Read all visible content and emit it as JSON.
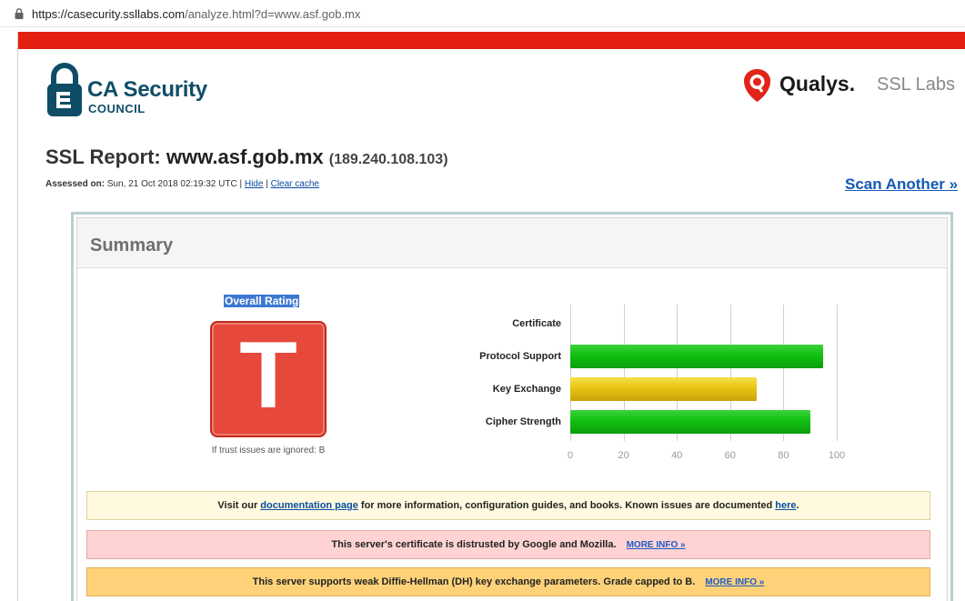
{
  "browser": {
    "url_host_prefix": "https://casecurity.ssllabs.com",
    "url_path": "/analyze.html?d=www.asf.gob.mx"
  },
  "header": {
    "ca_title": "CA Security",
    "ca_subtitle": "COUNCIL",
    "qualys_name": "Qualys.",
    "qualys_ssl": "SSL Labs"
  },
  "report": {
    "title_prefix": "SSL Report:",
    "domain": "www.asf.gob.mx",
    "ip": "(189.240.108.103)",
    "assessed_label": "Assessed on:",
    "assessed_value": "Sun, 21 Oct 2018 02:19:32 UTC |",
    "hide_link": "Hide",
    "separator": "|",
    "clear_cache_link": "Clear cache",
    "scan_another": "Scan Another »"
  },
  "summary": {
    "title": "Summary",
    "overall_label": "Overall Rating",
    "grade": "T",
    "trust_note": "If trust issues are ignored: B",
    "colors": {
      "grade_bg": "#e6493b",
      "bar_green": "#11c011",
      "bar_yellow": "#e8c412"
    }
  },
  "chart_data": {
    "type": "bar",
    "orientation": "horizontal",
    "categories": [
      "Certificate",
      "Protocol Support",
      "Key Exchange",
      "Cipher Strength"
    ],
    "values": [
      0,
      95,
      70,
      90
    ],
    "xlim": [
      0,
      100
    ],
    "ticks": [
      "0",
      "20",
      "40",
      "60",
      "80",
      "100"
    ],
    "grid": true
  },
  "notices": {
    "docs_pre": "Visit our",
    "docs_link": "documentation page",
    "docs_mid": "for more information, configuration guides, and books. Known issues are documented",
    "docs_here": "here",
    "docs_end": ".",
    "distrust_text": "This server's certificate is distrusted by Google and Mozilla.",
    "dh_text": "This server supports weak Diffie-Hellman (DH) key exchange parameters. Grade capped to B.",
    "more_info": "MORE INFO »"
  }
}
